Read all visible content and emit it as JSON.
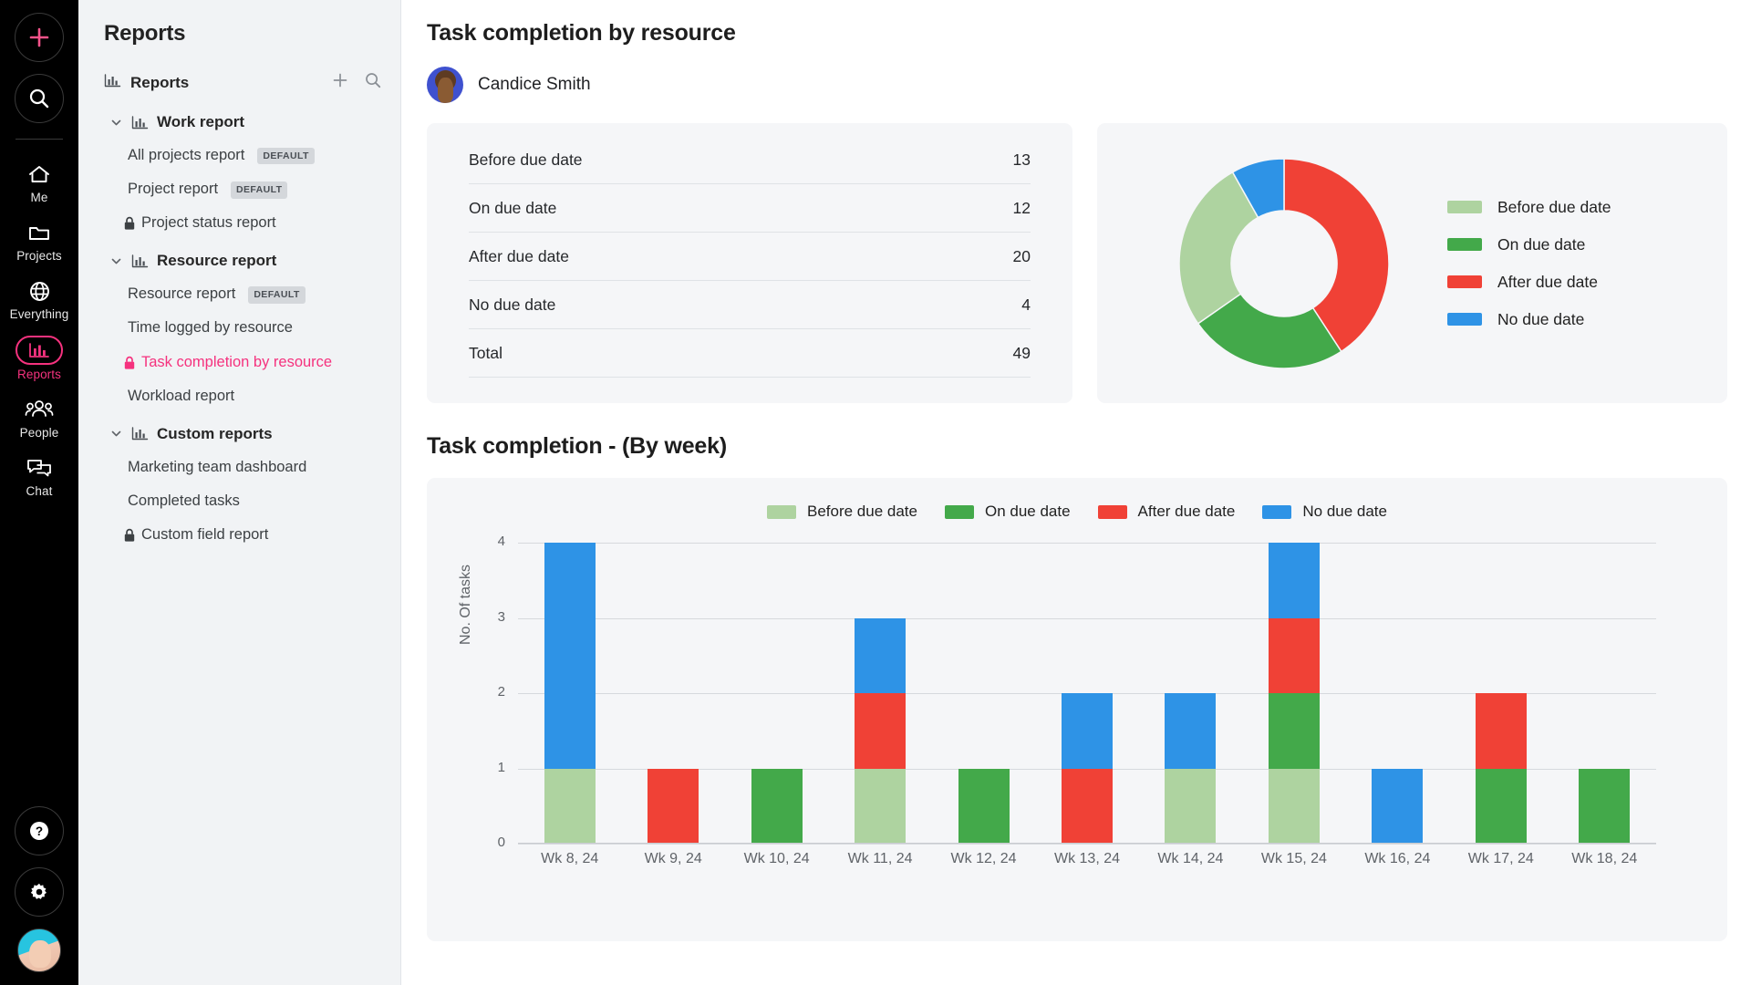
{
  "rail": {
    "add_label": "add-new",
    "search_label": "search",
    "items": [
      {
        "icon": "home-icon",
        "label": "Me",
        "active": false
      },
      {
        "icon": "folder-icon",
        "label": "Projects",
        "active": false
      },
      {
        "icon": "globe-icon",
        "label": "Everything",
        "active": false
      },
      {
        "icon": "bar-chart-icon",
        "label": "Reports",
        "active": true
      },
      {
        "icon": "people-icon",
        "label": "People",
        "active": false
      },
      {
        "icon": "chat-icon",
        "label": "Chat",
        "active": false
      }
    ],
    "help_label": "Help",
    "settings_label": "Settings",
    "profile_label": "Profile"
  },
  "sidebar": {
    "title": "Reports",
    "section_header": "Reports",
    "add_tooltip": "Add report",
    "search_tooltip": "Search reports",
    "groups": [
      {
        "label": "Work report",
        "items": [
          {
            "label": "All projects report",
            "badge": "DEFAULT",
            "locked": false,
            "active": false
          },
          {
            "label": "Project report",
            "badge": "DEFAULT",
            "locked": false,
            "active": false
          },
          {
            "label": "Project status report",
            "badge": "",
            "locked": true,
            "active": false
          }
        ]
      },
      {
        "label": "Resource report",
        "items": [
          {
            "label": "Resource report",
            "badge": "DEFAULT",
            "locked": false,
            "active": false
          },
          {
            "label": "Time logged by resource",
            "badge": "",
            "locked": false,
            "active": false
          },
          {
            "label": "Task completion by resource",
            "badge": "",
            "locked": true,
            "active": true
          },
          {
            "label": "Workload report",
            "badge": "",
            "locked": false,
            "active": false
          }
        ]
      },
      {
        "label": "Custom reports",
        "items": [
          {
            "label": "Marketing team dashboard",
            "badge": "",
            "locked": false,
            "active": false
          },
          {
            "label": "Completed tasks",
            "badge": "",
            "locked": false,
            "active": false
          },
          {
            "label": "Custom field report",
            "badge": "",
            "locked": true,
            "active": false
          }
        ]
      }
    ]
  },
  "main": {
    "page_title": "Task completion by resource",
    "resource_name": "Candice Smith",
    "section_title": "Task completion - (By week)"
  },
  "summary_table": {
    "rows": [
      {
        "label": "Before due date",
        "value": "13"
      },
      {
        "label": "On due date",
        "value": "12"
      },
      {
        "label": "After due date",
        "value": "20"
      },
      {
        "label": "No due date",
        "value": "4"
      },
      {
        "label": "Total",
        "value": "49"
      }
    ]
  },
  "colors": {
    "before_due_date": "#aed3a0",
    "on_due_date": "#43a94a",
    "after_due_date": "#f04136",
    "no_due_date": "#2e93e6",
    "accent_pink": "#f5327e",
    "card_bg": "#f5f6f8",
    "sidebar_bg": "#f1f3f5"
  },
  "chart_data": [
    {
      "type": "pie",
      "title": "",
      "donut": true,
      "legend_position": "right",
      "labels": [
        "Before due date",
        "On due date",
        "After due date",
        "No due date"
      ],
      "values": [
        13,
        12,
        20,
        4
      ],
      "total": 49,
      "colors": [
        "#aed3a0",
        "#43a94a",
        "#f04136",
        "#2e93e6"
      ]
    },
    {
      "type": "bar",
      "title": "Task completion - (By week)",
      "stacked": true,
      "xlabel": "",
      "ylabel": "No. Of tasks",
      "ylim": [
        0,
        4
      ],
      "yticks": [
        0,
        1,
        2,
        3,
        4
      ],
      "grid": true,
      "legend_position": "top",
      "categories": [
        "Wk 8, 24",
        "Wk 9, 24",
        "Wk 10, 24",
        "Wk 11, 24",
        "Wk 12, 24",
        "Wk 13, 24",
        "Wk 14, 24",
        "Wk 15, 24",
        "Wk 16, 24",
        "Wk 17, 24",
        "Wk 18, 24"
      ],
      "series": [
        {
          "name": "Before due date",
          "color": "#aed3a0",
          "values": [
            1,
            0,
            0,
            1,
            0,
            0,
            1,
            1,
            0,
            0,
            0
          ]
        },
        {
          "name": "On due date",
          "color": "#43a94a",
          "values": [
            0,
            0,
            1,
            0,
            1,
            0,
            0,
            1,
            0,
            1,
            1
          ]
        },
        {
          "name": "After due date",
          "color": "#f04136",
          "values": [
            0,
            1,
            0,
            1,
            0,
            1,
            0,
            1,
            0,
            1,
            0
          ]
        },
        {
          "name": "No due date",
          "color": "#2e93e6",
          "values": [
            3,
            0,
            0,
            1,
            0,
            1,
            1,
            1,
            1,
            0,
            0
          ]
        }
      ],
      "totals": [
        4,
        1,
        1,
        3,
        1,
        2,
        2,
        4,
        1,
        2,
        1
      ]
    }
  ],
  "bar_legend": [
    {
      "label": "Before due date",
      "color": "#aed3a0"
    },
    {
      "label": "On due date",
      "color": "#43a94a"
    },
    {
      "label": "After due date",
      "color": "#f04136"
    },
    {
      "label": "No due date",
      "color": "#2e93e6"
    }
  ]
}
